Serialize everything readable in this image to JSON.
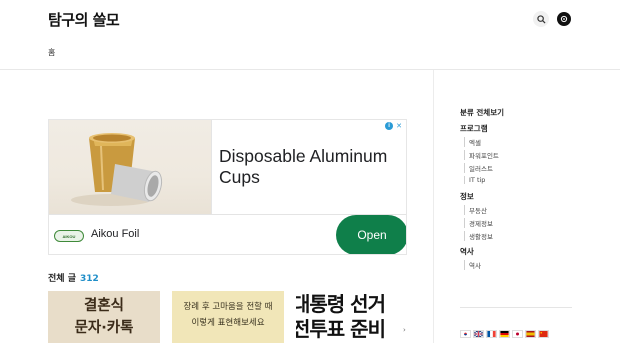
{
  "header": {
    "site_title": "탐구의 쓸모",
    "nav_home": "홈",
    "search_icon": "search-icon",
    "profile_icon": "profile-avatar-icon"
  },
  "ad": {
    "headline": "Disposable Aluminum Cups",
    "advertiser": "Aikou Foil",
    "logo_text": "AIKOU",
    "cta": "Open",
    "choices_icon": "ad-choices-icon",
    "close_icon": "close-icon"
  },
  "posts": {
    "label": "전체 글",
    "count": "312",
    "thumbnails": [
      {
        "line1": "결혼식",
        "line2": "문자·카톡"
      },
      {
        "line1": "장례 후 고마움을 전할 때",
        "line2": "이렇게 표현해보세요"
      },
      {
        "line1": "대통령 선거",
        "line2": "전투표 준비"
      }
    ],
    "next_icon": "chevron-right-icon"
  },
  "sidebar": {
    "heading": "분류 전체보기",
    "categories": [
      {
        "label": "프로그램",
        "items": [
          "엑셀",
          "파워포인트",
          "일러스트",
          "IT tip"
        ]
      },
      {
        "label": "정보",
        "items": [
          "부동산",
          "경제정보",
          "생활정보"
        ]
      },
      {
        "label": "역사",
        "items": [
          "역사"
        ]
      }
    ]
  },
  "flags": [
    "flag-korea-icon",
    "flag-uk-icon",
    "flag-france-icon",
    "flag-germany-icon",
    "flag-japan-icon",
    "flag-spain-icon",
    "flag-china-icon"
  ],
  "colors": {
    "accent": "#1f8ec8",
    "cta_green": "#0f7f4a"
  }
}
